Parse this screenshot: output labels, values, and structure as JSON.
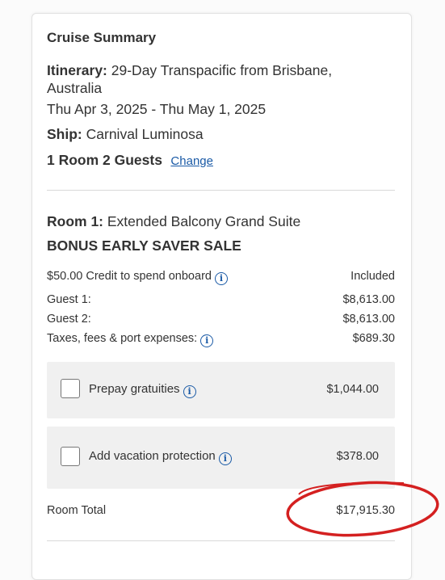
{
  "summary": {
    "title": "Cruise Summary",
    "itinerary_label": "Itinerary:",
    "itinerary_line1": "29-Day Transpacific from Brisbane,",
    "itinerary_line2": "Australia",
    "dates": "Thu Apr 3, 2025 - Thu May 1, 2025",
    "ship_label": "Ship:",
    "ship_name": "Carnival Luminosa",
    "rooms_guests": "1 Room 2 Guests",
    "change_link": "Change"
  },
  "room": {
    "room_label": "Room 1:",
    "room_type": "Extended Balcony Grand Suite",
    "promo": "BONUS EARLY SAVER SALE",
    "lines": [
      {
        "label": "$50.00 Credit to spend onboard",
        "value": "Included",
        "info": true
      },
      {
        "label": "Guest 1:",
        "value": "$8,613.00",
        "info": false
      },
      {
        "label": "Guest 2:",
        "value": "$8,613.00",
        "info": false
      },
      {
        "label": "Taxes, fees & port expenses:",
        "value": "$689.30",
        "info": true
      }
    ]
  },
  "addons": [
    {
      "label": "Prepay gratuities",
      "price": "$1,044.00",
      "checked": false
    },
    {
      "label": "Add vacation protection",
      "price": "$378.00",
      "checked": false
    }
  ],
  "total": {
    "label": "Room Total",
    "value": "$17,915.30"
  },
  "colors": {
    "link": "#1a5aa6",
    "annotation": "#d42020",
    "addon_bg": "#f0f0f0"
  }
}
